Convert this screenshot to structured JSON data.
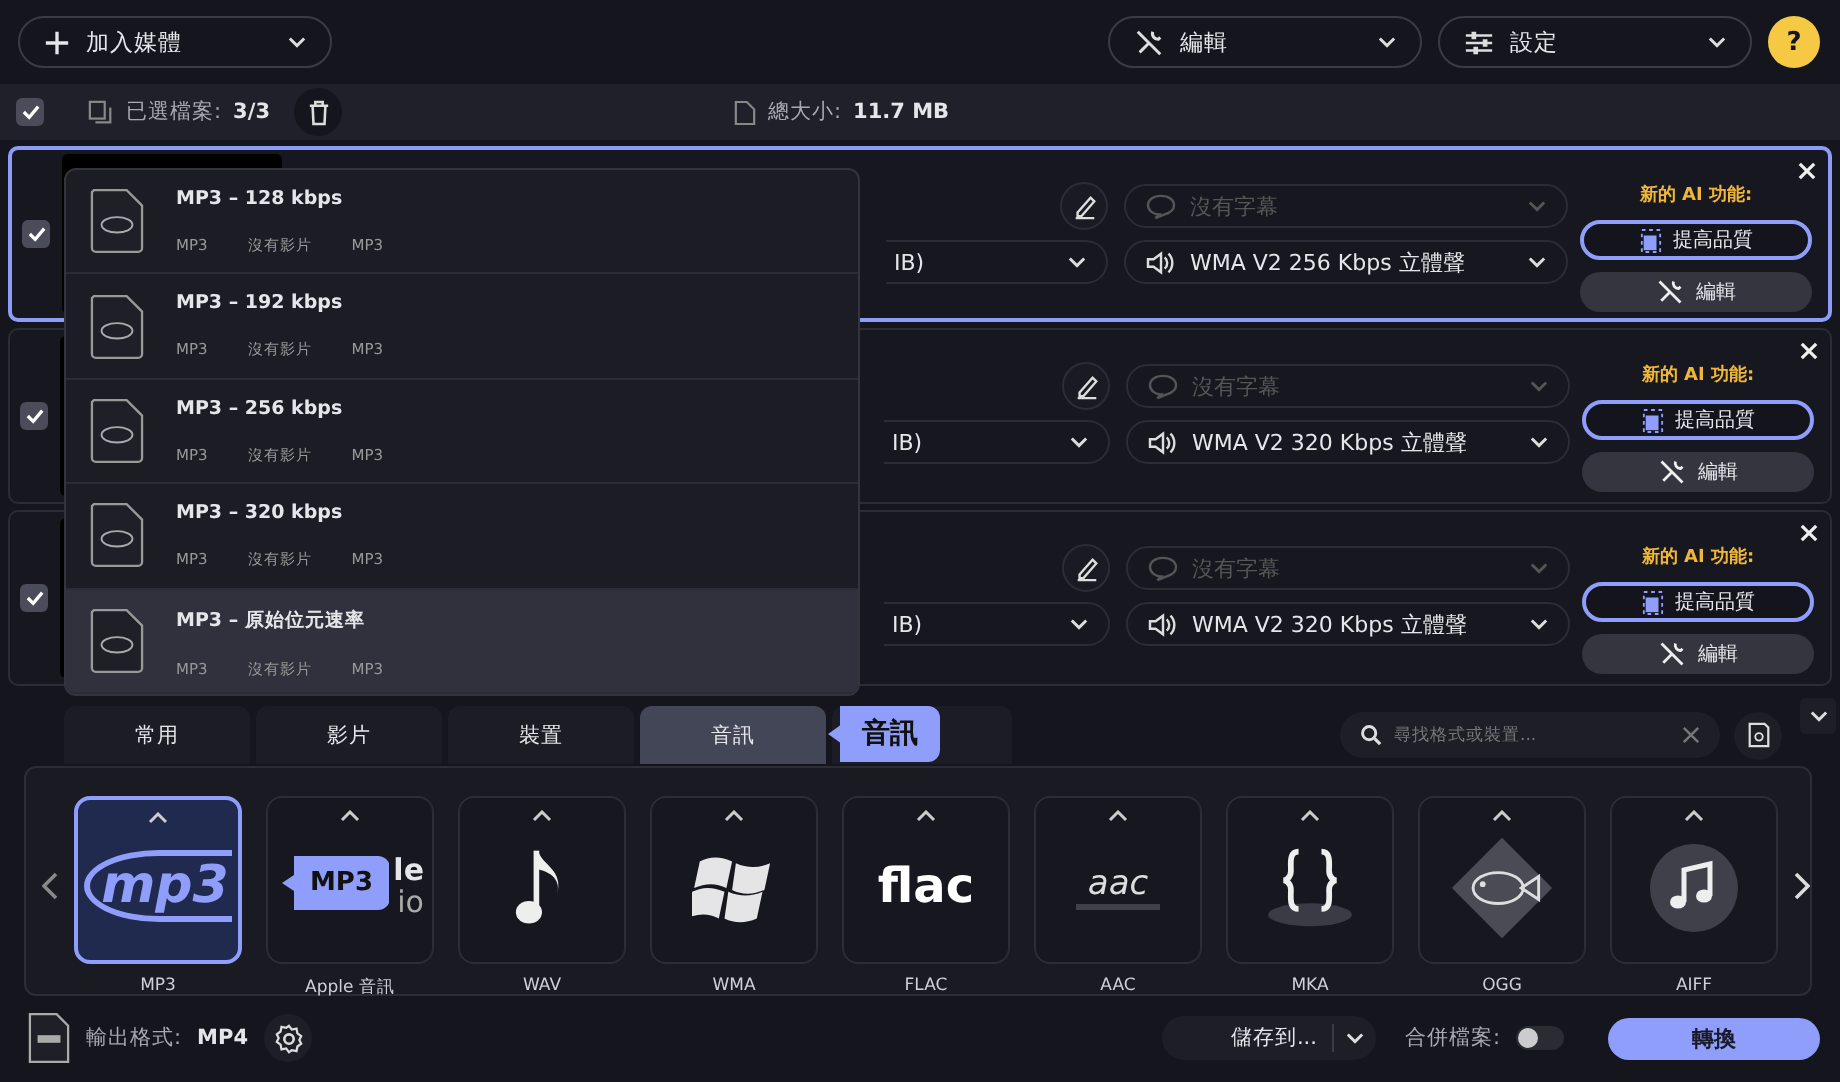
{
  "top_bar": {
    "add_media": "加入媒體",
    "edit_menu": "編輯",
    "settings_menu": "設定",
    "help": "?"
  },
  "toolbar": {
    "select_all_checked": true,
    "selected_label": "已選檔案:",
    "selected_count": "3/3",
    "total_label": "總大小:",
    "total_size": "11.7 MB"
  },
  "files": [
    {
      "checked": true,
      "selected": true,
      "format_text": "IB)",
      "subtitle_placeholder": "沒有字幕",
      "audio": "WMA V2 256 Kbps 立體聲",
      "ai_label": "新的 AI 功能:",
      "enhance": "提高品質",
      "edit": "編輯"
    },
    {
      "checked": true,
      "selected": false,
      "format_text": "IB)",
      "subtitle_placeholder": "沒有字幕",
      "audio": "WMA V2 320 Kbps 立體聲",
      "ai_label": "新的 AI 功能:",
      "enhance": "提高品質",
      "edit": "編輯"
    },
    {
      "checked": true,
      "selected": false,
      "format_text": "IB)",
      "subtitle_placeholder": "沒有字幕",
      "audio": "WMA V2 320 Kbps 立體聲",
      "ai_label": "新的 AI 功能:",
      "enhance": "提高品質",
      "edit": "編輯"
    }
  ],
  "format_popup": {
    "items": [
      {
        "title": "MP3 – 128 kbps",
        "meta": [
          "MP3",
          "沒有影片",
          "MP3"
        ],
        "selected": false
      },
      {
        "title": "MP3 – 192 kbps",
        "meta": [
          "MP3",
          "沒有影片",
          "MP3"
        ],
        "selected": false
      },
      {
        "title": "MP3 – 256 kbps",
        "meta": [
          "MP3",
          "沒有影片",
          "MP3"
        ],
        "selected": false
      },
      {
        "title": "MP3 – 320 kbps",
        "meta": [
          "MP3",
          "沒有影片",
          "MP3"
        ],
        "selected": false
      },
      {
        "title": "MP3 – 原始位元速率",
        "meta": [
          "MP3",
          "沒有影片",
          "MP3"
        ],
        "selected": true
      }
    ]
  },
  "tabs": [
    {
      "label": "常用",
      "selected": false
    },
    {
      "label": "影片",
      "selected": false
    },
    {
      "label": "裝置",
      "selected": false
    },
    {
      "label": "音訊",
      "selected": true
    }
  ],
  "tab_tooltip": "音訊",
  "search": {
    "placeholder": "尋找格式或裝置..."
  },
  "formats": [
    {
      "kind": "mp3",
      "label": "MP3",
      "logo_text": "mp3",
      "selected": true
    },
    {
      "kind": "apple",
      "label": "Apple 音訊",
      "logo_lines": [
        "le",
        "io"
      ],
      "selected": false
    },
    {
      "kind": "wav",
      "label": "WAV",
      "selected": false
    },
    {
      "kind": "wma",
      "label": "WMA",
      "selected": false
    },
    {
      "kind": "flac",
      "label": "FLAC",
      "logo_text": "flac",
      "selected": false
    },
    {
      "kind": "aac",
      "label": "AAC",
      "logo_text": "aac",
      "selected": false
    },
    {
      "kind": "mka",
      "label": "MKA",
      "selected": false
    },
    {
      "kind": "ogg",
      "label": "OGG",
      "selected": false
    },
    {
      "kind": "aiff",
      "label": "AIFF",
      "selected": false
    }
  ],
  "format_tooltip": "MP3",
  "bottom_bar": {
    "output_label": "輸出格式:",
    "output_format": "MP4",
    "save_to": "儲存到...",
    "merge_label": "合併檔案:",
    "merge_on": false,
    "convert": "轉換"
  }
}
